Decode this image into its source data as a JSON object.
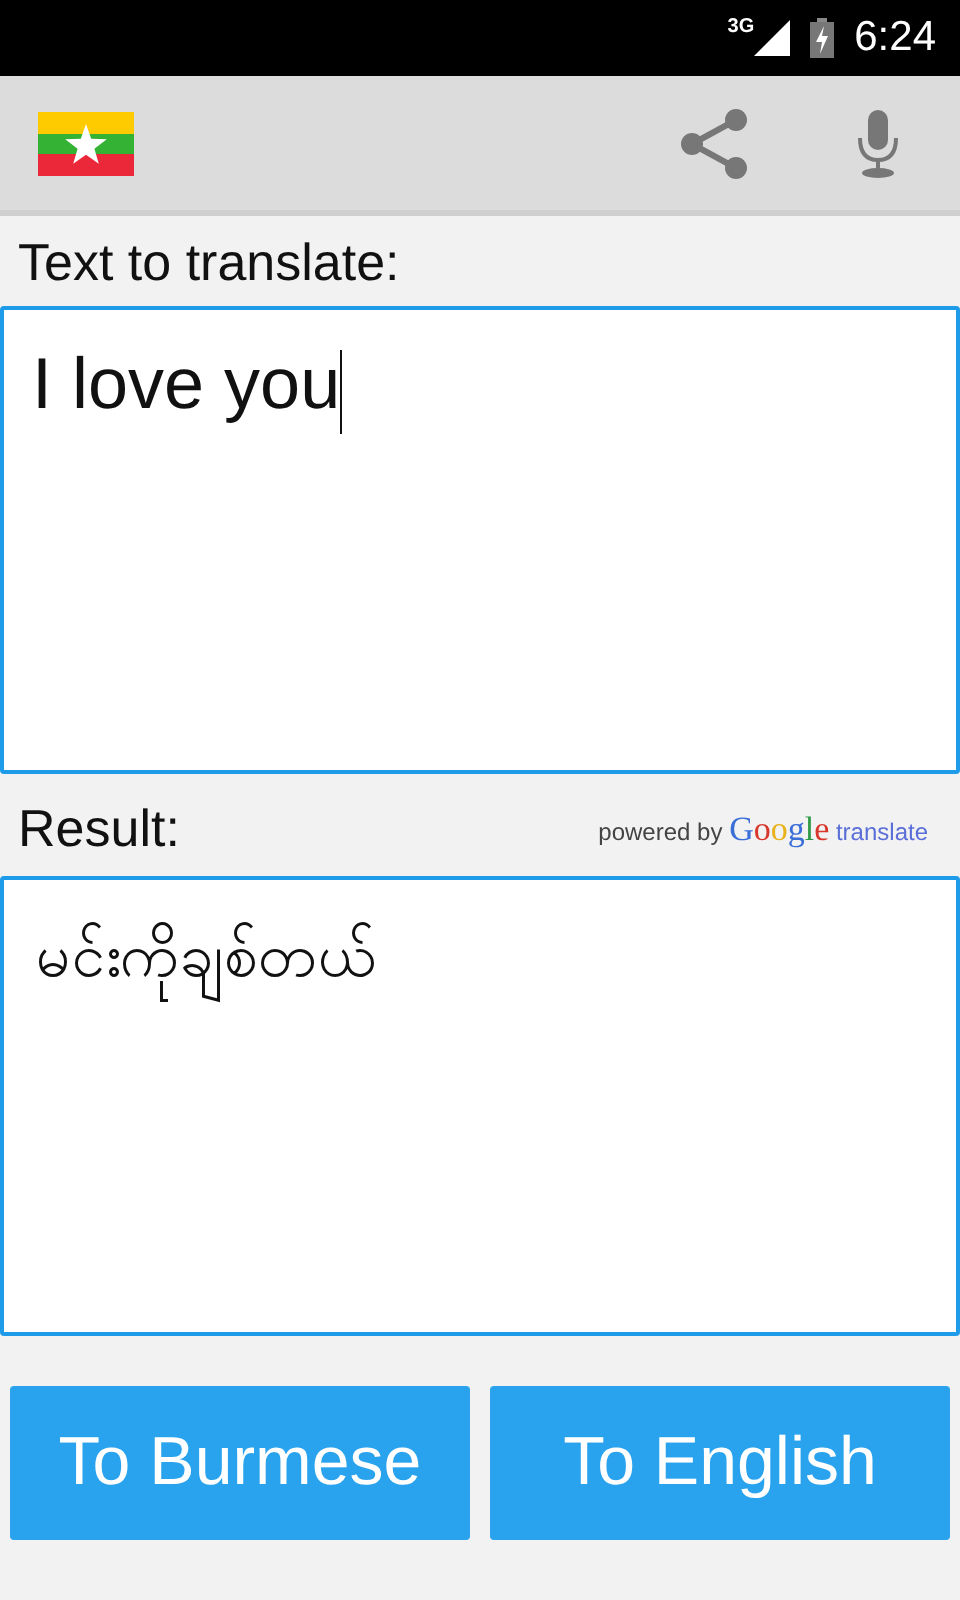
{
  "status_bar": {
    "network": "3G",
    "time": "6:24"
  },
  "source": {
    "label": "Text to translate:",
    "value": "I love you"
  },
  "result": {
    "label": "Result:",
    "powered_by": "powered by",
    "brand": "Google",
    "brand_suffix": "translate",
    "value": "မင်းကိုချစ်တယ်"
  },
  "buttons": [
    "To Burmese",
    "To English"
  ]
}
